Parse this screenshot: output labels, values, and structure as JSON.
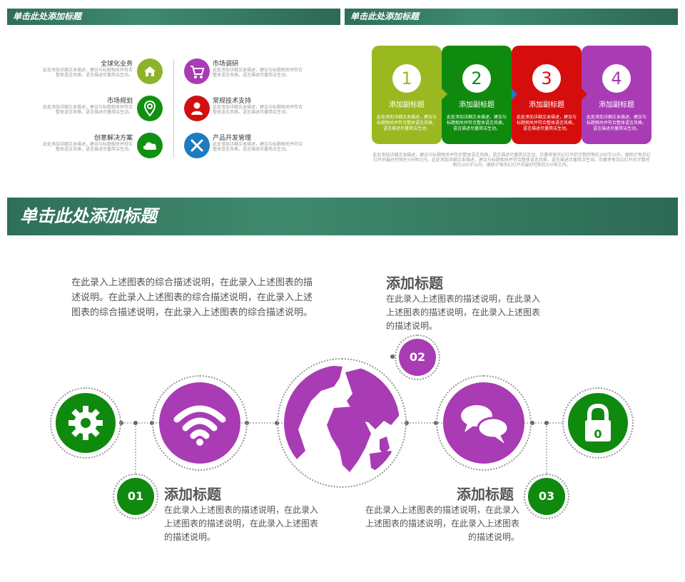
{
  "slide1": {
    "banner_title": "单击此处添加标题",
    "items": [
      {
        "label": "全球化业务",
        "desc": "此处添加详细文本描述，建议与标题相关并符合整体语言风格，语言描述尽量简洁生动。",
        "icon": "home-icon",
        "color": "#8db32a"
      },
      {
        "label": "市场规划",
        "desc": "此处添加详细文本描述，建议与标题相关并符合整体语言风格，语言描述尽量简洁生动。",
        "icon": "location-pin-icon",
        "color": "#119011"
      },
      {
        "label": "创意解决方案",
        "desc": "此处添加详细文本描述，建议与标题相关并符合整体语言风格，语言描述尽量简洁生动。",
        "icon": "cloud-icon",
        "color": "#119011"
      },
      {
        "label": "市场调研",
        "desc": "此处添加详细文本描述，建议与标题相关并符合整体语言风格，语言描述尽量简洁生动。",
        "icon": "cart-icon",
        "color": "#a93bb5"
      },
      {
        "label": "常规技术支持",
        "desc": "此处添加详细文本描述，建议与标题相关并符合整体语言风格，语言描述尽量简洁生动。",
        "icon": "person-icon",
        "color": "#d40f0f"
      },
      {
        "label": "产品开发管理",
        "desc": "此处添加详细文本描述，建议与标题相关并符合整体语言风格，语言描述尽量简洁生动。",
        "icon": "tools-icon",
        "color": "#1e7bc0"
      }
    ]
  },
  "slide2": {
    "banner_title": "单击此处添加标题",
    "cards": [
      {
        "num": "1",
        "subtitle": "添加副标题",
        "desc": "此处添加详细文本描述，建议与标题相关并符合整体语言风格，语言描述尽量简洁生动。",
        "color": "#9ab820"
      },
      {
        "num": "2",
        "subtitle": "添加副标题",
        "desc": "此处添加详细文本描述，建议与标题相关并符合整体语言风格，语言描述尽量简洁生动。",
        "color": "#0f8a0f"
      },
      {
        "num": "3",
        "subtitle": "添加副标题",
        "desc": "此处添加详细文本描述，建议与标题相关并符合整体语言风格，语言描述尽量简洁生动。",
        "color": "#d50d0d"
      },
      {
        "num": "4",
        "subtitle": "添加副标题",
        "desc": "此处添加详细文本描述，建议与标题相关并符合整体语言风格，语言描述尽量简洁生动。",
        "color": "#a93bb5"
      }
    ],
    "footer": "此处添加详细文本描述，建议与标题相关并符合整体语言风格，语言描述尽量简洁生动。尽量将每页幻灯片的字数控制在200字以内，据统计每页幻灯片的最好控制在5分钟之内。此处添加详细文本描述，建议与标题相关并符合整体语言风格，语言描述尽量简洁生动。尽量将每页幻灯片的字数控制在200字以内，据统计每页幻灯片的最好控制在5分钟之内。"
  },
  "slide3": {
    "banner_title": "单击此处添加标题",
    "intro": "在此录入上述图表的综合描述说明，在此录入上述图表的描述说明。在此录入上述图表的综合描述说明，在此录入上述图表的综合描述说明，在此录入上述图表的综合描述说明。",
    "items": [
      {
        "badge": "01",
        "title": "添加标题",
        "desc": "在此录入上述图表的描述说明，在此录入上述图表的描述说明，在此录入上述图表的描述说明。"
      },
      {
        "badge": "02",
        "title": "添加标题",
        "desc": "在此录入上述图表的描述说明，在此录入上述图表的描述说明，在此录入上述图表的描述说明。"
      },
      {
        "badge": "03",
        "title": "添加标题",
        "desc": "在此录入上述图表的描述说明，在此录入上述图表的描述说明，在此录入上述图表的描述说明。"
      }
    ],
    "lock_digit": "0",
    "colors": {
      "green": "#0f8a0f",
      "purple": "#a93bb5"
    },
    "icons": [
      "gear-icon",
      "wifi-icon",
      "globe-icon",
      "chat-bubbles-icon",
      "lock-icon"
    ]
  }
}
